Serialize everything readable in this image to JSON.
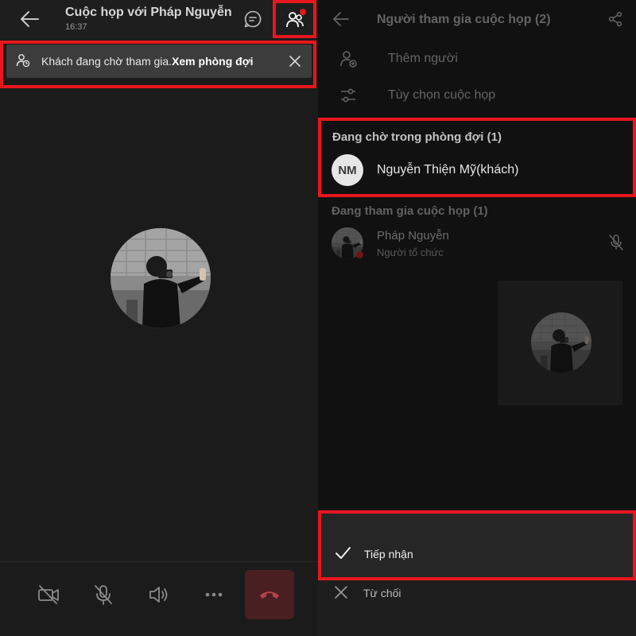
{
  "left_panel": {
    "header": {
      "title": "Cuộc họp với Pháp Nguyễn",
      "time": "16:37"
    },
    "banner": {
      "text": "Khách đang chờ tham gia.",
      "link": "Xem phòng đợi"
    },
    "controls": {
      "camera": "camera-off-icon",
      "mic": "mic-off-icon",
      "speaker": "speaker-icon",
      "more": "more-icon",
      "hangup": "hang-up-icon"
    }
  },
  "right_panel": {
    "header": {
      "title": "Người tham gia cuộc họp (2)"
    },
    "menu": {
      "add_people": "Thêm người",
      "meeting_options": "Tùy chọn cuộc họp"
    },
    "lobby": {
      "heading": "Đang chờ trong phòng đợi (1)",
      "guest_initials": "NM",
      "guest_name": "Nguyễn Thiện Mỹ(khách)"
    },
    "in_meeting": {
      "heading": "Đang tham gia cuộc họp (1)",
      "name": "Pháp Nguyễn",
      "role": "Người tổ chức"
    },
    "sheet": {
      "accept_label": "Tiếp nhận",
      "reject_label": "Từ chối"
    }
  },
  "colors": {
    "highlight": "#e8161d",
    "background_left": "#1b1b1b",
    "background_right": "#111111"
  }
}
